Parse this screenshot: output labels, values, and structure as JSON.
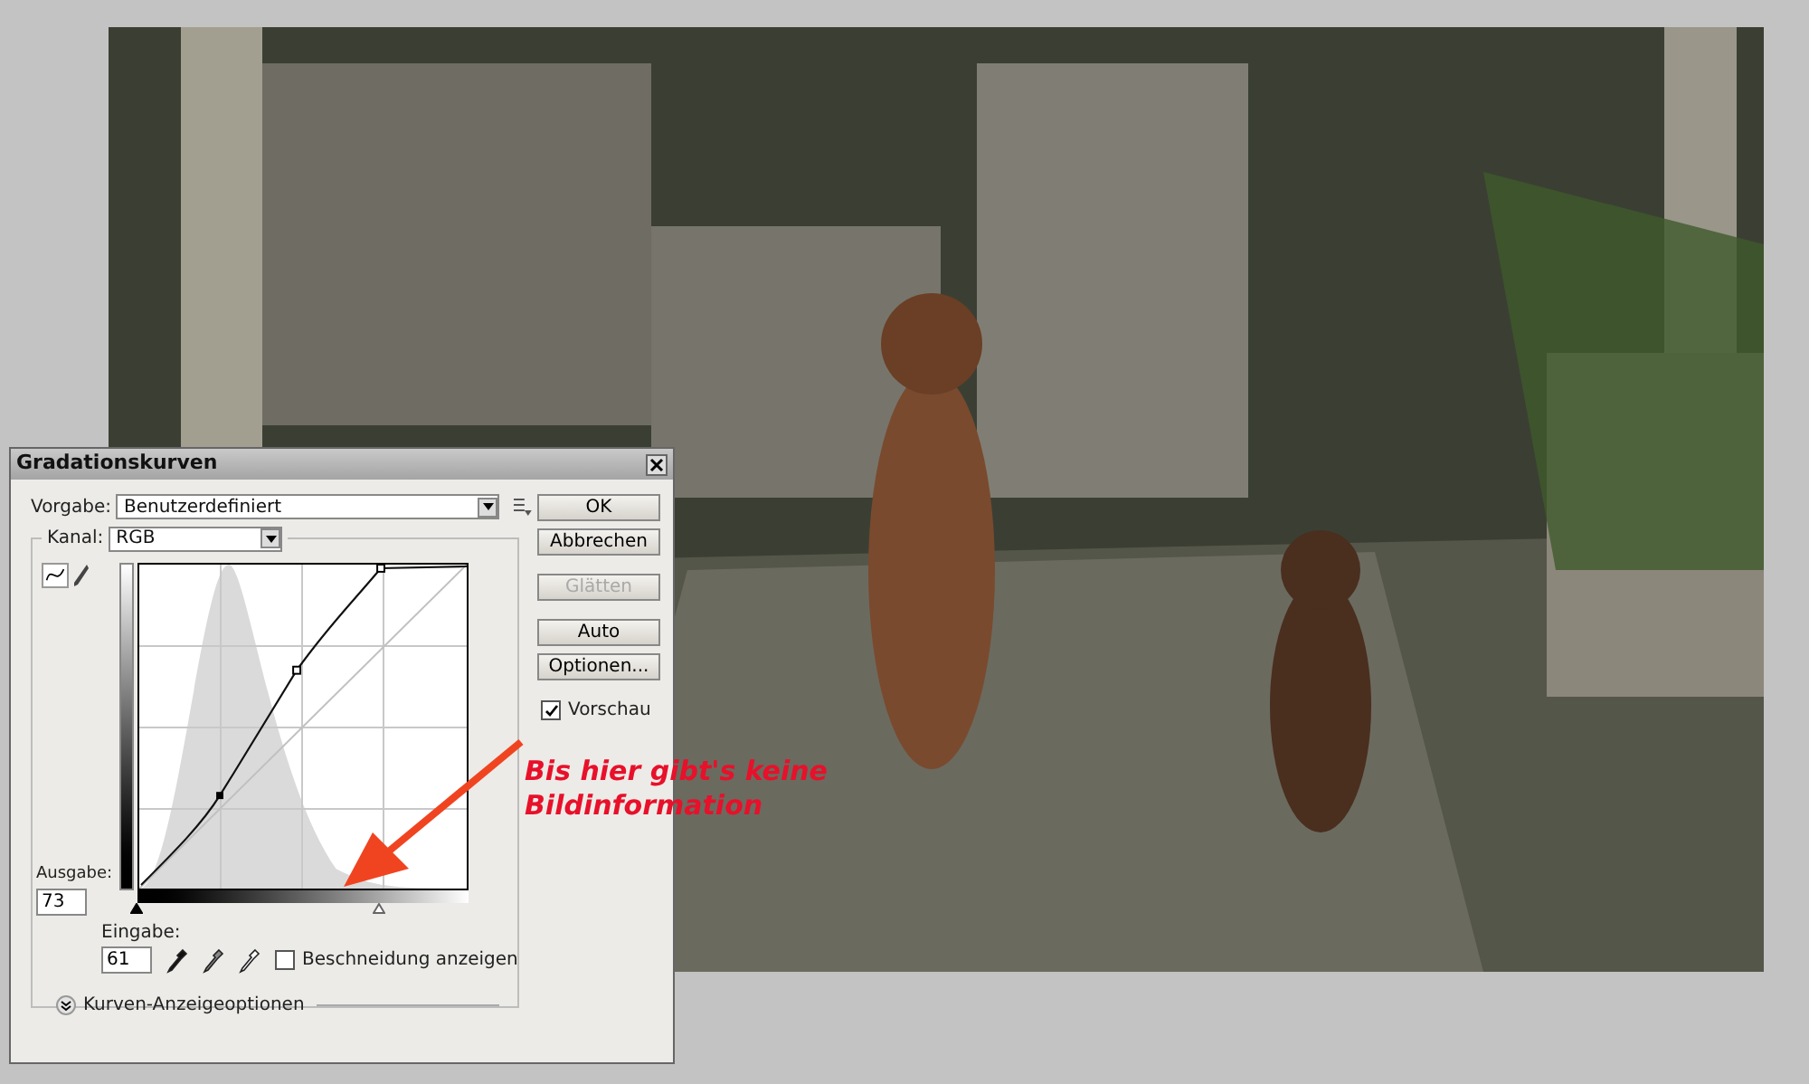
{
  "window": {
    "title": "Gradationskurven"
  },
  "preset": {
    "label": "Vorgabe:",
    "value": "Benutzerdefiniert"
  },
  "channel": {
    "label": "Kanal:",
    "value": "RGB"
  },
  "buttons": [
    {
      "label": "OK",
      "disabled": false
    },
    {
      "label": "Abbrechen",
      "disabled": false
    },
    {
      "label": "Glätten",
      "disabled": true
    },
    {
      "label": "Auto",
      "disabled": false
    },
    {
      "label": "Optionen...",
      "disabled": false
    }
  ],
  "preview": {
    "label": "Vorschau",
    "checked": true
  },
  "output": {
    "label": "Ausgabe:",
    "value": "73"
  },
  "input": {
    "label": "Eingabe:",
    "value": "61"
  },
  "input_sliders": [
    {
      "level": 0
    },
    {
      "level": 0.74
    }
  ],
  "clipping": {
    "label": "Beschneidung anzeigen",
    "checked": false
  },
  "display_options": {
    "label": "Kurven-Anzeigeoptionen"
  },
  "annotation": {
    "lines": [
      "Bis hier gibt's keine",
      "Bildinformation"
    ]
  }
}
